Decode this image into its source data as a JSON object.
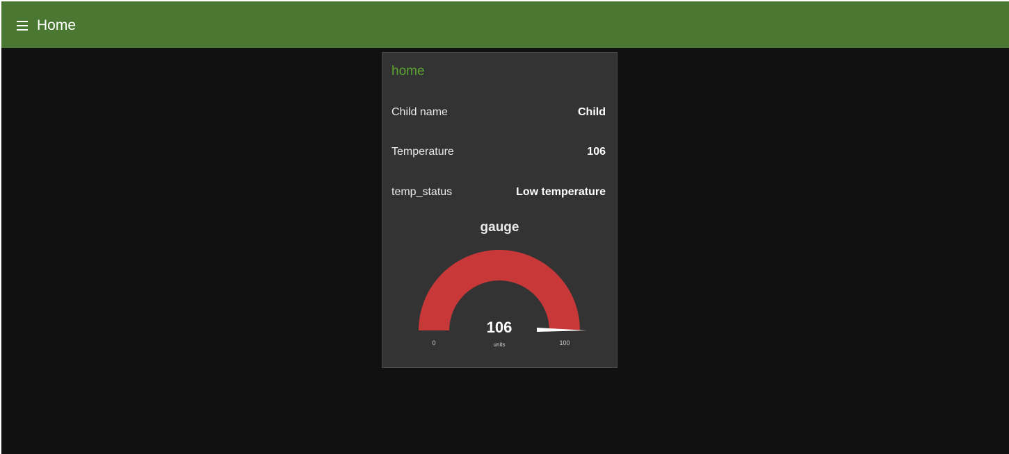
{
  "toolbar": {
    "title": "Home",
    "menu_icon": "hamburger-menu-icon",
    "color": "#4a7731"
  },
  "card": {
    "title": "home",
    "title_color": "#5aa332",
    "rows": [
      {
        "label": "Child name",
        "value": "Child"
      },
      {
        "label": "Temperature",
        "value": "106"
      },
      {
        "label": "temp_status",
        "value": "Low temperature"
      }
    ]
  },
  "gauge": {
    "title": "gauge",
    "value": 106,
    "value_text": "106",
    "units": "units",
    "min": 0,
    "max": 100,
    "min_label": "0",
    "max_label": "100",
    "fill_color": "#c83838"
  }
}
